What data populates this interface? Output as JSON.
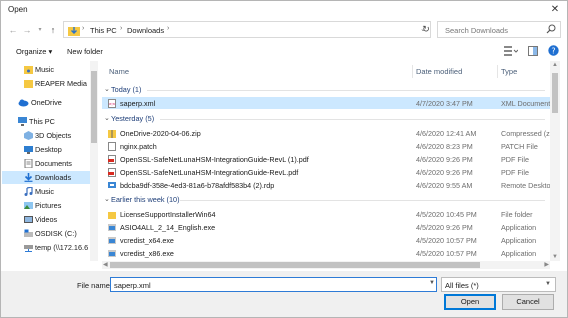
{
  "window": {
    "title": "Open",
    "close_label": "✕"
  },
  "address": {
    "crumbs": [
      "This PC",
      "Downloads"
    ],
    "search_placeholder": "Search Downloads"
  },
  "toolbar": {
    "organize": "Organize ▾",
    "new_folder": "New folder"
  },
  "nav": {
    "items": [
      {
        "label": "Music",
        "icon": "music-folder-icon"
      },
      {
        "label": "REAPER Media",
        "icon": "folder-icon"
      },
      {
        "label": "OneDrive",
        "icon": "cloud-icon"
      },
      {
        "label": "This PC",
        "icon": "pc-icon"
      },
      {
        "label": "3D Objects",
        "icon": "cube-icon"
      },
      {
        "label": "Desktop",
        "icon": "desktop-icon"
      },
      {
        "label": "Documents",
        "icon": "documents-icon"
      },
      {
        "label": "Downloads",
        "icon": "download-icon"
      },
      {
        "label": "Music",
        "icon": "music-icon"
      },
      {
        "label": "Pictures",
        "icon": "pictures-icon"
      },
      {
        "label": "Videos",
        "icon": "videos-icon"
      },
      {
        "label": "OSDISK (C:)",
        "icon": "drive-icon"
      },
      {
        "label": "temp (\\\\172.16.6",
        "icon": "network-drive-icon"
      }
    ],
    "selected": "Downloads"
  },
  "columns": {
    "name": "Name",
    "date": "Date modified",
    "type": "Type"
  },
  "groups": [
    {
      "label": "Today (1)",
      "files": [
        {
          "name": "saperp.xml",
          "date": "4/7/2020 3:47 PM",
          "type": "XML Document",
          "icon": "xml-file-icon",
          "selected": true
        }
      ]
    },
    {
      "label": "Yesterday (5)",
      "files": [
        {
          "name": "OneDrive-2020-04-06.zip",
          "date": "4/6/2020 12:41 AM",
          "type": "Compressed (zip",
          "icon": "zip-folder-icon"
        },
        {
          "name": "nginx.patch",
          "date": "4/6/2020 8:23 PM",
          "type": "PATCH File",
          "icon": "file-icon"
        },
        {
          "name": "OpenSSL-SafeNetLunaHSM-IntegrationGuide-RevL (1).pdf",
          "date": "4/6/2020 9:26 PM",
          "type": "PDF File",
          "icon": "pdf-icon"
        },
        {
          "name": "OpenSSL-SafeNetLunaHSM-IntegrationGuide-RevL.pdf",
          "date": "4/6/2020 9:26 PM",
          "type": "PDF File",
          "icon": "pdf-icon"
        },
        {
          "name": "bdcba9df-358e-4ed3-81a6-b78afdf583b4 (2).rdp",
          "date": "4/6/2020 9:55 AM",
          "type": "Remote Desktop",
          "icon": "rdp-icon"
        }
      ]
    },
    {
      "label": "Earlier this week (10)",
      "files": [
        {
          "name": "LicenseSupportInstallerWin64",
          "date": "4/5/2020 10:45 PM",
          "type": "File folder",
          "icon": "folder-icon"
        },
        {
          "name": "ASIO4ALL_2_14_English.exe",
          "date": "4/5/2020 9:26 PM",
          "type": "Application",
          "icon": "exe-icon"
        },
        {
          "name": "vcredist_x64.exe",
          "date": "4/5/2020 10:57 PM",
          "type": "Application",
          "icon": "exe-icon"
        },
        {
          "name": "vcredist_x86.exe",
          "date": "4/5/2020 10:57 PM",
          "type": "Application",
          "icon": "exe-icon"
        }
      ]
    }
  ],
  "bottom": {
    "file_name_label": "File name:",
    "file_name_value": "saperp.xml",
    "file_type": "All files (*)",
    "open": "Open",
    "cancel": "Cancel"
  },
  "colors": {
    "selection": "#cce8ff",
    "accent": "#0078d7",
    "group_text": "#1e3e78"
  }
}
